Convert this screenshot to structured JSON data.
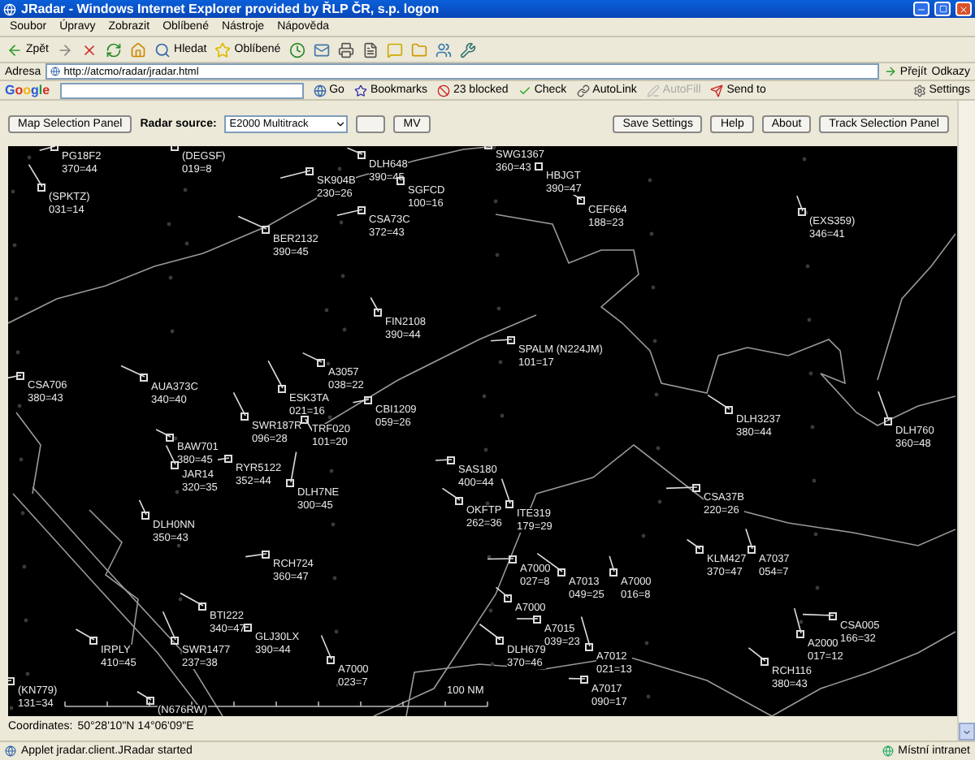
{
  "window": {
    "title": "JRadar - Windows Internet Explorer provided by ŘLP ČR, s.p. logon"
  },
  "menu": [
    "Soubor",
    "Úpravy",
    "Zobrazit",
    "Oblíbené",
    "Nástroje",
    "Nápověda"
  ],
  "toolbar": [
    {
      "kind": "back",
      "label": "Zpět"
    },
    {
      "kind": "forward"
    },
    {
      "kind": "stop"
    },
    {
      "kind": "refresh"
    },
    {
      "kind": "home"
    },
    {
      "kind": "search",
      "label": "Hledat"
    },
    {
      "kind": "favorites",
      "label": "Oblíbené"
    },
    {
      "kind": "history"
    },
    {
      "kind": "mail"
    },
    {
      "kind": "print"
    },
    {
      "kind": "edit"
    },
    {
      "kind": "discuss"
    },
    {
      "kind": "folder"
    },
    {
      "kind": "messenger"
    },
    {
      "kind": "tool"
    }
  ],
  "address": {
    "label": "Adresa",
    "url": "http://atcmo/radar/jradar.html",
    "go": "Přejít",
    "links": "Odkazy"
  },
  "google_bar": {
    "logo": "Google",
    "items": [
      {
        "kind": "go",
        "label": "Go",
        "disabled": false
      },
      {
        "kind": "bookmarks",
        "label": "Bookmarks",
        "disabled": false
      },
      {
        "kind": "blocked",
        "label": "23 blocked",
        "disabled": false
      },
      {
        "kind": "check",
        "label": "Check",
        "disabled": false
      },
      {
        "kind": "autolink",
        "label": "AutoLink",
        "disabled": false
      },
      {
        "kind": "autofill",
        "label": "AutoFill",
        "disabled": true
      },
      {
        "kind": "sendto",
        "label": "Send to",
        "disabled": false
      }
    ],
    "settings": "Settings"
  },
  "applet": {
    "map_button": "Map Selection Panel",
    "radar_source": {
      "label": "Radar source:",
      "value": "E2000 Multitrack"
    },
    "mv_button": "MV",
    "right_buttons": [
      "Save Settings",
      "Help",
      "About",
      "Track Selection Panel"
    ]
  },
  "radar": {
    "tracks": [
      {
        "callsign": "PG18F2",
        "info": "370=44"
      },
      {
        "callsign": "(DEGSF)",
        "info": "019=8"
      },
      {
        "callsign": "(SPKTZ)",
        "info": "031=14"
      },
      {
        "callsign": "SK904B",
        "info": "230=26"
      },
      {
        "callsign": "DLH648",
        "info": "390=45"
      },
      {
        "callsign": "SGFCD",
        "info": "100=16"
      },
      {
        "callsign": "CSA73C",
        "info": "372=43"
      },
      {
        "callsign": "BER2132",
        "info": "390=45"
      },
      {
        "callsign": "FIN2108",
        "info": "390=44"
      },
      {
        "callsign": "CSA706",
        "info": "380=43"
      },
      {
        "callsign": "AUA373C",
        "info": "340=40"
      },
      {
        "callsign": "ESK3TA",
        "info": "021=16"
      },
      {
        "callsign": "CBI1209",
        "info": "059=26"
      },
      {
        "callsign": "A3057",
        "info": "038=22"
      },
      {
        "callsign": "SWR187R",
        "info": "096=28"
      },
      {
        "callsign": "TRF020",
        "info": "101=20"
      },
      {
        "callsign": "BAW701",
        "info": "380=45"
      },
      {
        "callsign": "JAR14",
        "info": "320=35"
      },
      {
        "callsign": "RYR5122",
        "info": "352=44"
      },
      {
        "callsign": "DLH7NE",
        "info": "300=45"
      },
      {
        "callsign": "DLH0NN",
        "info": "350=43"
      },
      {
        "callsign": "RCH724",
        "info": "360=47"
      },
      {
        "callsign": "BTI222",
        "info": "340=47"
      },
      {
        "callsign": "SWR1477",
        "info": "237=38"
      },
      {
        "callsign": "GLJ30LX",
        "info": "390=44"
      },
      {
        "callsign": "IRPLY",
        "info": "410=45"
      },
      {
        "callsign": "A7000",
        "info": "023=7"
      },
      {
        "callsign": "(KN779)",
        "info": "131=34"
      },
      {
        "callsign": "(N676RW)"
      },
      {
        "callsign": "SWG1367",
        "info": "360=43"
      },
      {
        "callsign": "HBJGT",
        "info": "390=47"
      },
      {
        "callsign": "CEF664",
        "info": "188=23"
      },
      {
        "callsign": "(EXS359)",
        "info": "346=41"
      },
      {
        "callsign": "SPALM (N224JM)",
        "info": "101=17"
      },
      {
        "callsign": "DLH3237",
        "info": "380=44"
      },
      {
        "callsign": "DLH760",
        "info": "360=48"
      },
      {
        "callsign": "SAS180",
        "info": "400=44"
      },
      {
        "callsign": "OKFTP",
        "info": "262=36"
      },
      {
        "callsign": "ITE319",
        "info": "179=29"
      },
      {
        "callsign": "CSA37B",
        "info": "220=26"
      },
      {
        "callsign": "KLM427",
        "info": "370=47"
      },
      {
        "callsign": "A7037",
        "info": "054=7"
      },
      {
        "callsign": "A7000",
        "info": "027=8"
      },
      {
        "callsign": "A7013",
        "info": "049=25"
      },
      {
        "callsign": "A7000",
        "info": "016=8"
      },
      {
        "callsign": "A7015",
        "info": "039=23"
      },
      {
        "callsign": "DLH679",
        "info": "370=46"
      },
      {
        "callsign": "A7012",
        "info": "021=13"
      },
      {
        "callsign": "A7017",
        "info": "090=17"
      },
      {
        "callsign": "RCH116",
        "info": "380=43"
      },
      {
        "callsign": "A2000",
        "info": "017=12"
      },
      {
        "callsign": "CSA005",
        "info": "166=32"
      },
      {
        "callsign": "A7000"
      }
    ],
    "scale": "100 NM"
  },
  "coordinates": {
    "label": "Coordinates:",
    "value": "50°28'10\"N  14°06'09\"E"
  },
  "status_bar": {
    "text": "Applet jradar.client.JRadar started",
    "zone": "Místní intranet"
  }
}
